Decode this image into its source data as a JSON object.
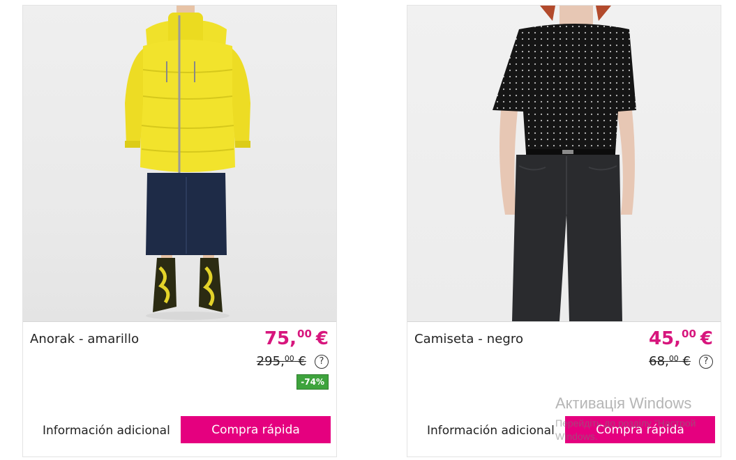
{
  "products": [
    {
      "name": "Anorak - amarillo",
      "price_main": "75,",
      "price_cents": "00",
      "currency": "€",
      "old_main": "295,",
      "old_cents": "00",
      "old_currency": "€",
      "help_symbol": "?",
      "discount": "-74%",
      "info_label": "Información adicional",
      "buy_label": "Compra rápida",
      "image": "model-yellow-anorak-photo"
    },
    {
      "name": "Camiseta - negro",
      "price_main": "45,",
      "price_cents": "00",
      "currency": "€",
      "old_main": "68,",
      "old_cents": "00",
      "old_currency": "€",
      "help_symbol": "?",
      "info_label": "Información adicional",
      "buy_label": "Compra rápida",
      "image": "model-black-tshirt-photo"
    }
  ],
  "watermark": {
    "title": "Активація Windows",
    "line1": "Перейдіть до розділу \"Настрой",
    "line2": "Windows."
  },
  "colors": {
    "price": "#d7167d",
    "button": "#e5007f",
    "discount": "#3ea33d"
  }
}
